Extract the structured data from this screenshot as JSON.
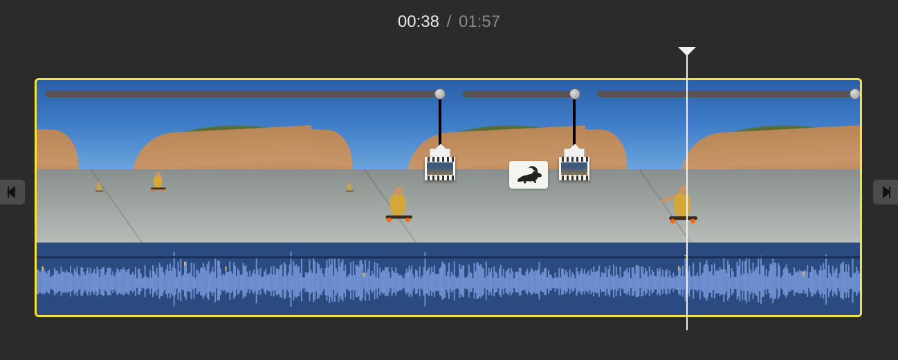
{
  "timecode": {
    "current": "00:38",
    "separator": "/",
    "total": "01:57"
  },
  "timeline": {
    "selected": true,
    "speed_indicator": "rabbit-icon",
    "icons": {
      "speed_handle": "filmstrip-icon",
      "edge_left": "trim-start-icon",
      "edge_right": "trim-end-icon",
      "playhead": "playhead-marker"
    }
  }
}
